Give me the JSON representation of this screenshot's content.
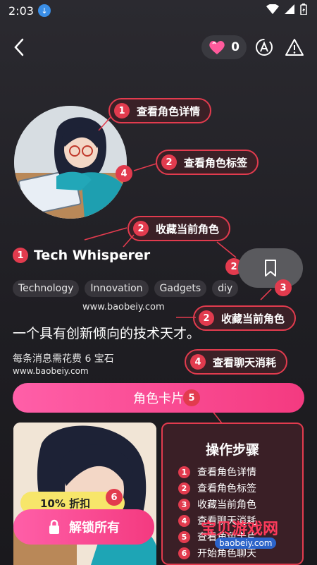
{
  "status": {
    "time": "2:03"
  },
  "header": {
    "gem_count": "0"
  },
  "callouts": [
    {
      "num": "1",
      "label": "查看角色详情"
    },
    {
      "num": "2",
      "label": "查看角色标签"
    },
    {
      "num": "2",
      "label": "收藏当前角色"
    },
    {
      "num": "2",
      "label": "收藏当前角色"
    },
    {
      "num": "4",
      "label": "查看聊天消耗"
    }
  ],
  "badges": {
    "avatar": "4",
    "name": "1",
    "bookmark_left": "2",
    "bookmark_right": "3",
    "card": "5",
    "discount": "6"
  },
  "character": {
    "name": "Tech Whisperer",
    "tags": [
      "Technology",
      "Innovation",
      "Gadgets",
      "diy"
    ],
    "description": "一个具有创新倾向的技术天才。",
    "cost": "每条消息需花费 6 宝石"
  },
  "watermark": "www.baobeiy.com",
  "card_button": "角色卡片",
  "discount": "10% 折扣",
  "unlock": "解锁所有",
  "steps": {
    "title": "操作步骤",
    "items": [
      {
        "num": "1",
        "label": "查看角色详情"
      },
      {
        "num": "2",
        "label": "查看角色标签"
      },
      {
        "num": "3",
        "label": "收藏当前角色"
      },
      {
        "num": "4",
        "label": "查看聊天消耗"
      },
      {
        "num": "5",
        "label": "查看角色卡片"
      },
      {
        "num": "6",
        "label": "开始角色聊天"
      }
    ]
  },
  "logo": {
    "text": "宝贝游戏网",
    "url": "baobeiy.com"
  },
  "colors": {
    "accent": "#e23b4e",
    "pink": "#f43a80",
    "yellow": "#f7e66a"
  }
}
